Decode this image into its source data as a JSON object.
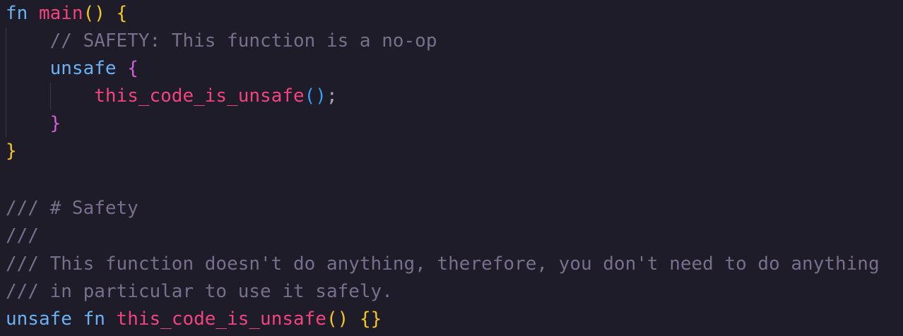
{
  "code": {
    "line1": {
      "kw": "fn",
      "name": "main",
      "parens": "()",
      "brace": "{"
    },
    "line2": {
      "comment": "// SAFETY: This function is a no-op"
    },
    "line3": {
      "kw": "unsafe",
      "brace": "{"
    },
    "line4": {
      "call": "this_code_is_unsafe",
      "parens": "()",
      "semi": ";"
    },
    "line5": {
      "brace": "}"
    },
    "line6": {
      "brace": "}"
    },
    "line8": {
      "comment": "/// # Safety"
    },
    "line9": {
      "comment": "///"
    },
    "line10": {
      "comment": "/// This function doesn't do anything, therefore, you don't need to do anything"
    },
    "line11": {
      "comment": "/// in particular to use it safely."
    },
    "line12": {
      "kw1": "unsafe",
      "kw2": "fn",
      "name": "this_code_is_unsafe",
      "parens": "()",
      "braces": "{}"
    }
  },
  "colors": {
    "background": "#1f1c29",
    "keyword": "#6ab1f2",
    "function": "#f2437f",
    "comment": "#76708c",
    "bracket_level1": "#f5c61f",
    "bracket_level2": "#d25fd8",
    "bracket_level3": "#2fa0f6"
  }
}
